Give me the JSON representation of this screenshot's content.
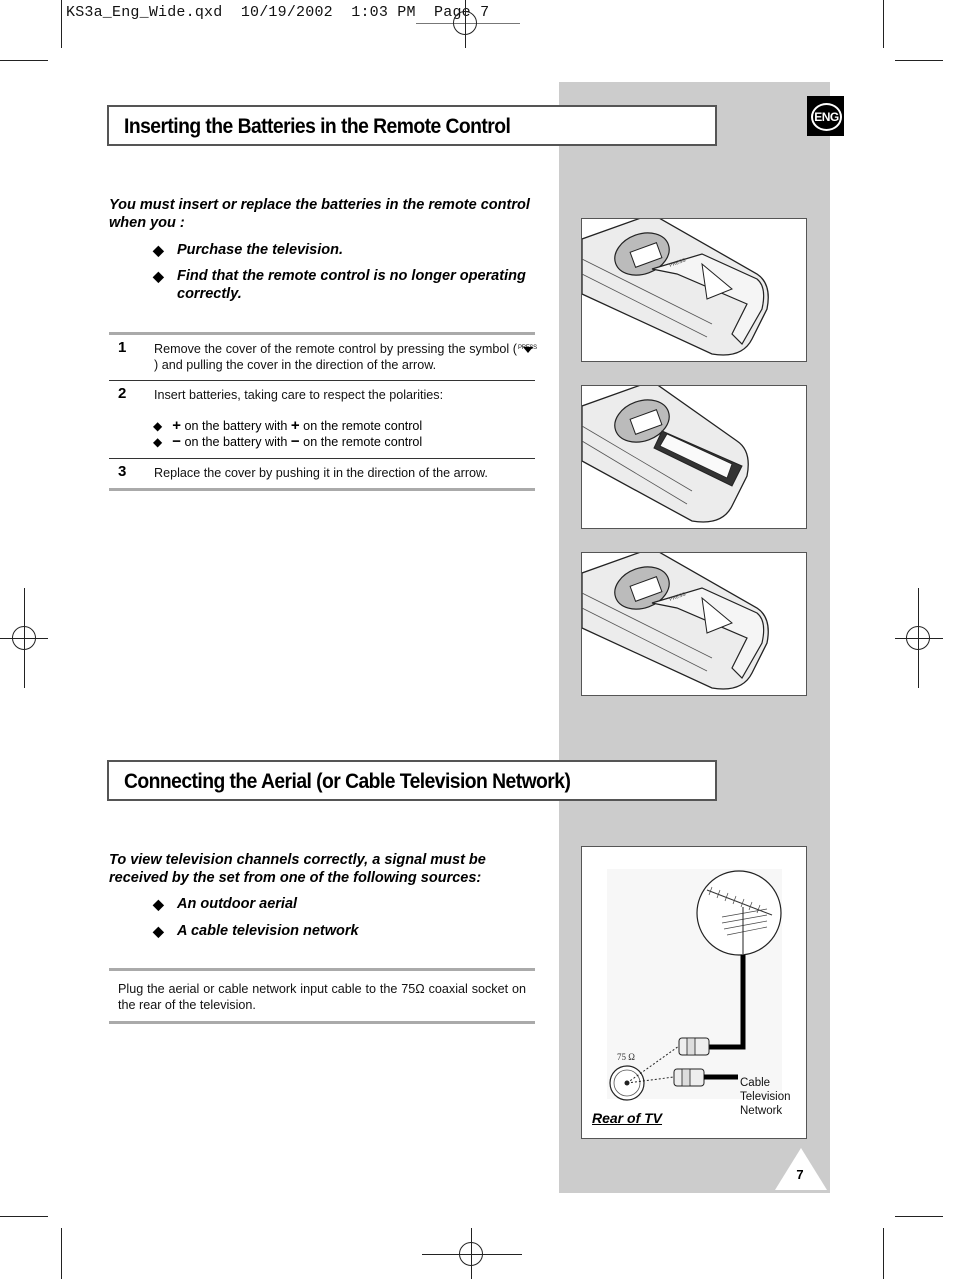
{
  "print_header": {
    "slug": "KS3a_Eng_Wide.qxd  10/19/2002  1:03 PM  Page 7"
  },
  "badge": {
    "label": "ENG",
    "icon": "language-badge-icon"
  },
  "section1": {
    "title": "Inserting the Batteries in the Remote Control",
    "intro": "You must insert or replace the batteries in the remote control when you :",
    "bullets": [
      "Purchase the television.",
      "Find that the remote control is no longer operating correctly."
    ],
    "bullet_glyph": "◆",
    "steps": [
      {
        "number": "1",
        "text_before": "Remove the cover of the remote control by pressing the symbol (",
        "symbol_label": "PRESS",
        "symbol_icon": "press-arrow-icon",
        "text_after": ") and pulling the cover in the direction of the arrow."
      },
      {
        "number": "2",
        "text": "Insert batteries, taking care to respect the polarities:",
        "polarities": [
          {
            "sign": "+",
            "pre": " on the battery with ",
            "post": " on the remote control"
          },
          {
            "sign": "−",
            "pre": " on the battery with ",
            "post": " on the remote control"
          }
        ]
      },
      {
        "number": "3",
        "text": "Replace the cover by pushing it in the direction of the arrow."
      }
    ],
    "figures": [
      {
        "name": "remote-cover-removal-illustration",
        "press_text": "PRESS"
      },
      {
        "name": "remote-battery-insertion-illustration"
      },
      {
        "name": "remote-cover-replacement-illustration",
        "press_text": "PRESS"
      }
    ]
  },
  "section2": {
    "title": "Connecting the Aerial (or Cable Television Network)",
    "intro": "To view television channels correctly, a signal must be received by the set from one of the following sources:",
    "bullets": [
      "An outdoor aerial",
      "A cable television network"
    ],
    "bullet_glyph": "◆",
    "instruction": "Plug the aerial or cable network input cable to the 75Ω  coaxial socket on the rear of the television.",
    "figure": {
      "socket_label": "75 Ω",
      "cable_label_lines": [
        "Cable",
        "Television",
        "Network"
      ],
      "caption": "Rear of TV"
    }
  },
  "page_number": "7"
}
